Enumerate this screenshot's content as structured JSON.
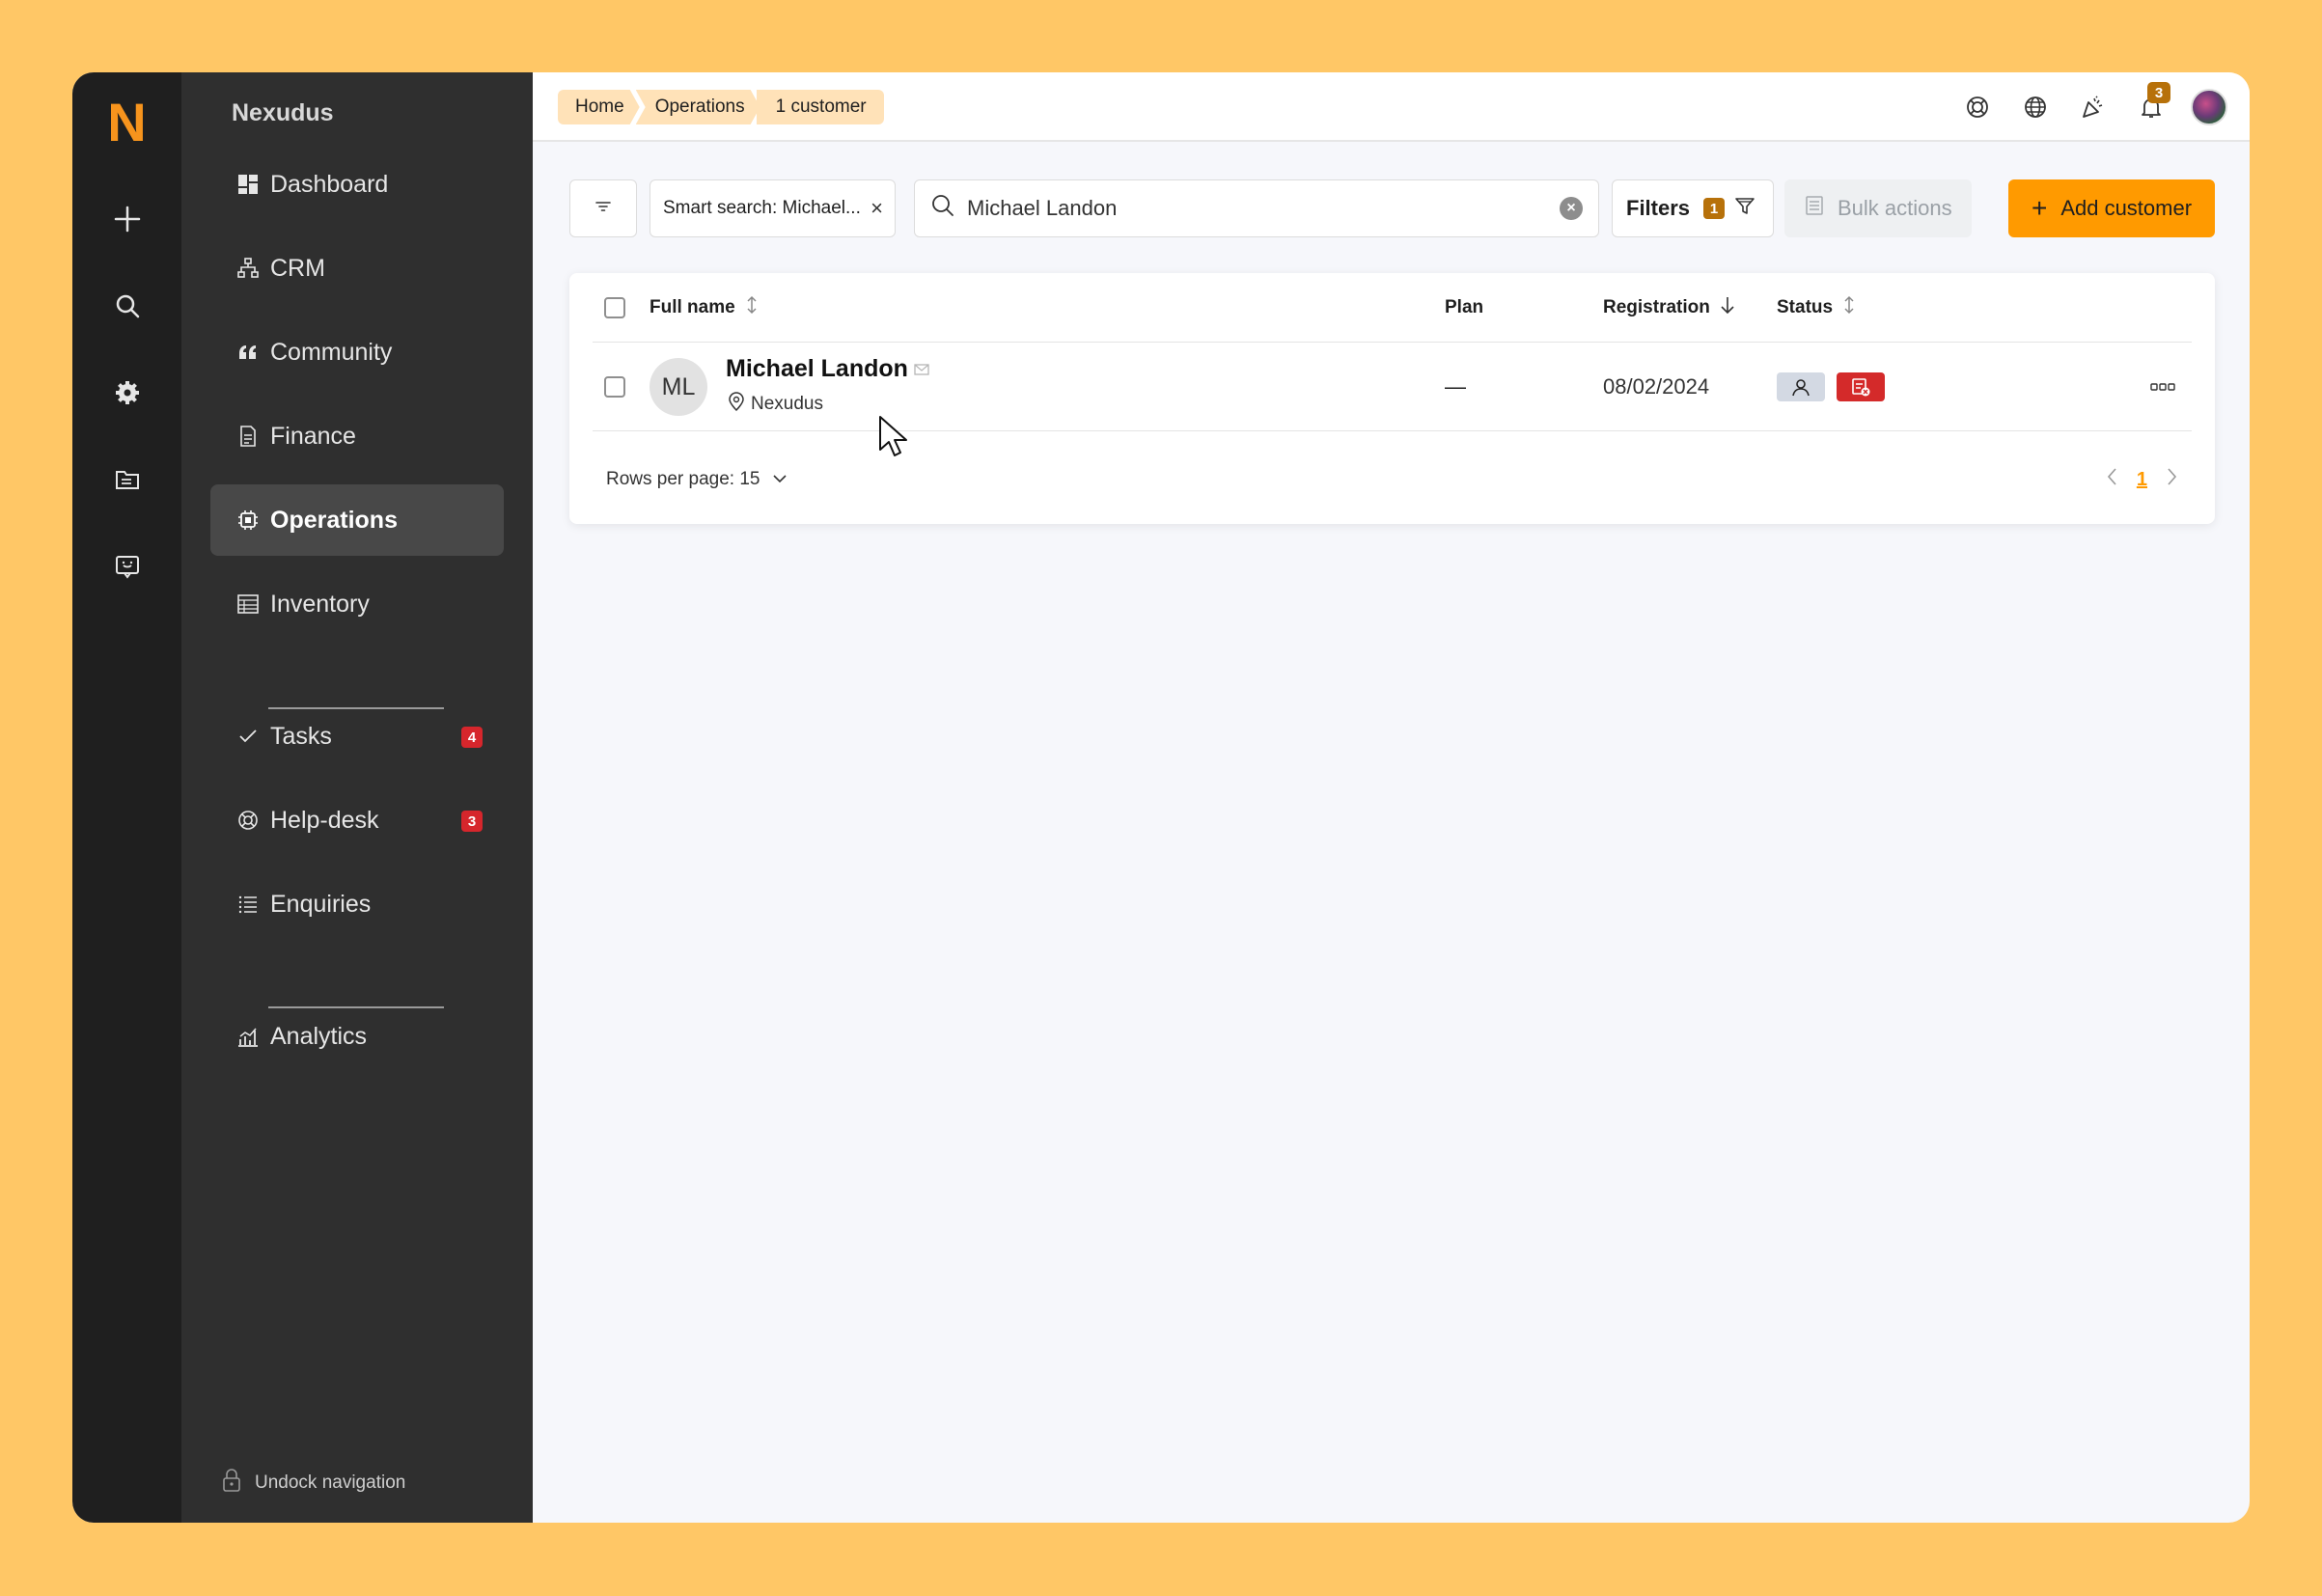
{
  "brand": {
    "logo": "N",
    "name": "Nexudus"
  },
  "colors": {
    "accent": "#FF9A00",
    "sidebar": "#2f2f2f",
    "rail": "#1f1f1f",
    "badge_red": "#d6262c",
    "badge_brown": "#B7710A"
  },
  "rail": {
    "icons": [
      "plus-icon",
      "search-icon",
      "gear-icon",
      "folder-icon",
      "chat-icon"
    ]
  },
  "sidebar": {
    "items": [
      {
        "label": "Dashboard",
        "icon": "dashboard-icon"
      },
      {
        "label": "CRM",
        "icon": "crm-icon"
      },
      {
        "label": "Community",
        "icon": "quote-icon"
      },
      {
        "label": "Finance",
        "icon": "document-icon"
      },
      {
        "label": "Operations",
        "icon": "chip-icon",
        "active": true
      },
      {
        "label": "Inventory",
        "icon": "table-icon"
      },
      {
        "label": "Tasks",
        "icon": "check-icon",
        "badge": "4"
      },
      {
        "label": "Help-desk",
        "icon": "lifebuoy-icon",
        "badge": "3"
      },
      {
        "label": "Enquiries",
        "icon": "list-icon"
      },
      {
        "label": "Analytics",
        "icon": "chart-icon"
      }
    ],
    "undock_label": "Undock navigation"
  },
  "breadcrumbs": [
    "Home",
    "Operations",
    "1 customer"
  ],
  "topbar": {
    "notification_count": "3"
  },
  "toolbar": {
    "smart_search_chip": "Smart search: Michael...",
    "search_value": "Michael Landon",
    "filters_label": "Filters",
    "filters_count": "1",
    "bulk_actions_label": "Bulk actions",
    "add_customer_label": "Add customer"
  },
  "table": {
    "columns": [
      "Full name",
      "Plan",
      "Registration",
      "Status"
    ],
    "rows": [
      {
        "initials": "ML",
        "name": "Michael Landon",
        "location": "Nexudus",
        "plan": "—",
        "registration": "08/02/2024"
      }
    ],
    "rows_per_page_label": "Rows per page: 15",
    "current_page": "1"
  }
}
